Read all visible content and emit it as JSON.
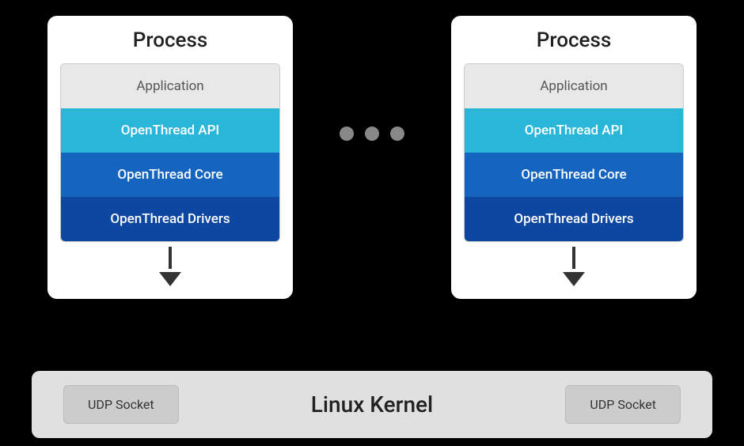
{
  "diagram": {
    "process_label": "Process",
    "dots": [
      "•",
      "•",
      "•"
    ],
    "left_process": {
      "title": "Process",
      "layers": [
        {
          "id": "application",
          "label": "Application",
          "type": "application"
        },
        {
          "id": "api",
          "label": "OpenThread API",
          "type": "api"
        },
        {
          "id": "core",
          "label": "OpenThread Core",
          "type": "core"
        },
        {
          "id": "drivers",
          "label": "OpenThread Drivers",
          "type": "drivers"
        }
      ]
    },
    "right_process": {
      "title": "Process",
      "layers": [
        {
          "id": "application",
          "label": "Application",
          "type": "application"
        },
        {
          "id": "api",
          "label": "OpenThread API",
          "type": "api"
        },
        {
          "id": "core",
          "label": "OpenThread Core",
          "type": "core"
        },
        {
          "id": "drivers",
          "label": "OpenThread Drivers",
          "type": "drivers"
        }
      ]
    },
    "bottom": {
      "linux_kernel_label": "Linux Kernel",
      "left_udp": "UDP Socket",
      "right_udp": "UDP Socket"
    }
  }
}
